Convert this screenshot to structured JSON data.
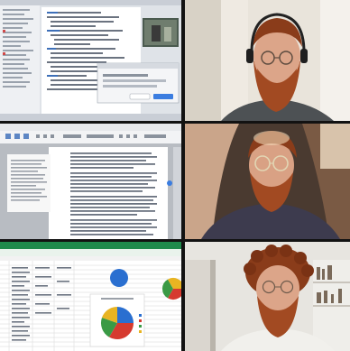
{
  "grid": {
    "rows": 3,
    "columns": 2,
    "left_column": [
      {
        "screen": "code-editor-with-video-preview",
        "dialog_visible": true
      },
      {
        "screen": "word-processor-document"
      },
      {
        "screen": "spreadsheet-with-pie-charts"
      }
    ],
    "right_column": [
      {
        "subject": "man-with-headphones-and-glasses"
      },
      {
        "subject": "man-with-round-glasses-in-car-seat"
      },
      {
        "subject": "man-with-curly-hair-by-bookshelf"
      }
    ]
  },
  "colors": {
    "divider": "#121212",
    "beard": "#a24a22",
    "hair": "#8a3c1a",
    "skin": "#dca589",
    "pie_blue": "#2a6fd0",
    "pie_red": "#d63a2f",
    "pie_green": "#3a9a45",
    "pie_yellow": "#e8b422",
    "sheet_green": "#1f8a4c"
  }
}
